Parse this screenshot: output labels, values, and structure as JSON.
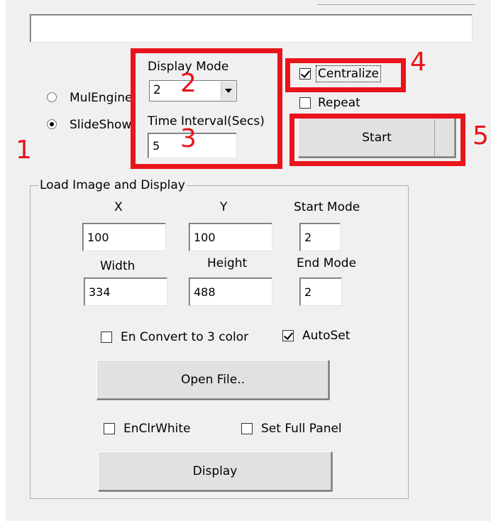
{
  "mode_radios": {
    "mul_engine": "MulEngine",
    "slide_show": "SlideShow"
  },
  "display_mode": {
    "label": "Display Mode",
    "value": "2"
  },
  "time_interval": {
    "label": "Time Interval(Secs)",
    "value": "5"
  },
  "options": {
    "centralize": "Centralize",
    "repeat": "Repeat"
  },
  "start_button": "Start",
  "load_group": {
    "title": "Load Image and Display",
    "x_label": "X",
    "y_label": "Y",
    "start_mode_label": "Start Mode",
    "x_value": "100",
    "y_value": "100",
    "start_mode_value": "2",
    "width_label": "Width",
    "height_label": "Height",
    "end_mode_label": "End Mode",
    "width_value": "334",
    "height_value": "488",
    "end_mode_value": "2",
    "en_convert_label": "En Convert to 3 color",
    "autoset_label": "AutoSet",
    "open_file_button": "Open File..",
    "enclrwhite_label": "EnClrWhite",
    "set_full_panel_label": "Set Full Panel",
    "display_button": "Display"
  },
  "annotations": {
    "n1": "1",
    "n2": "2",
    "n3": "3",
    "n4": "4",
    "n5": "5",
    "color": "#e8141c"
  }
}
